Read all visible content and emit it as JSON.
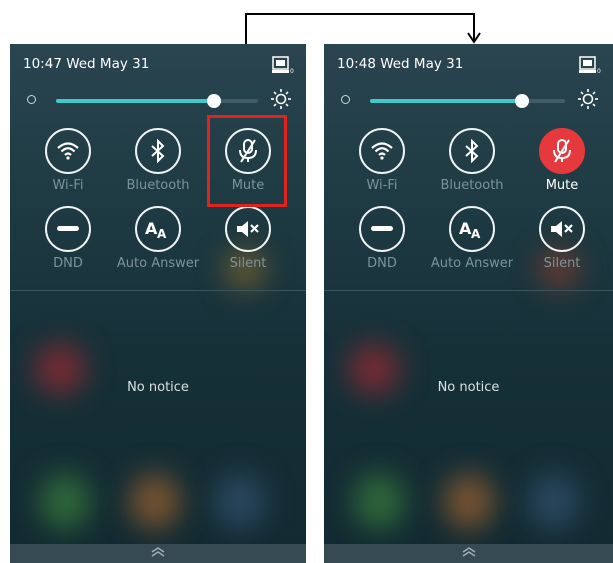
{
  "left": {
    "status_time": "10:47 Wed May 31",
    "toggles": {
      "wifi": "Wi-Fi",
      "bluetooth": "Bluetooth",
      "mute": "Mute",
      "dnd": "DND",
      "auto_answer": "Auto Answer",
      "silent": "Silent"
    },
    "mute_active": false,
    "notice": "No notice",
    "brightness_level": 0.78
  },
  "right": {
    "status_time": "10:48 Wed May 31",
    "toggles": {
      "wifi": "Wi-Fi",
      "bluetooth": "Bluetooth",
      "mute": "Mute",
      "dnd": "DND",
      "auto_answer": "Auto Answer",
      "silent": "Silent"
    },
    "mute_active": true,
    "notice": "No notice",
    "brightness_level": 0.78
  },
  "icons": [
    "wifi-icon",
    "bluetooth-icon",
    "mute-icon",
    "dnd-icon",
    "auto-answer-icon",
    "silent-icon",
    "brightness-icon",
    "phone-status-icon",
    "chevron-up-icon"
  ],
  "colors": {
    "accent": "#3fc9c9",
    "mute_active": "#e6393d",
    "highlight": "#e1231f"
  }
}
